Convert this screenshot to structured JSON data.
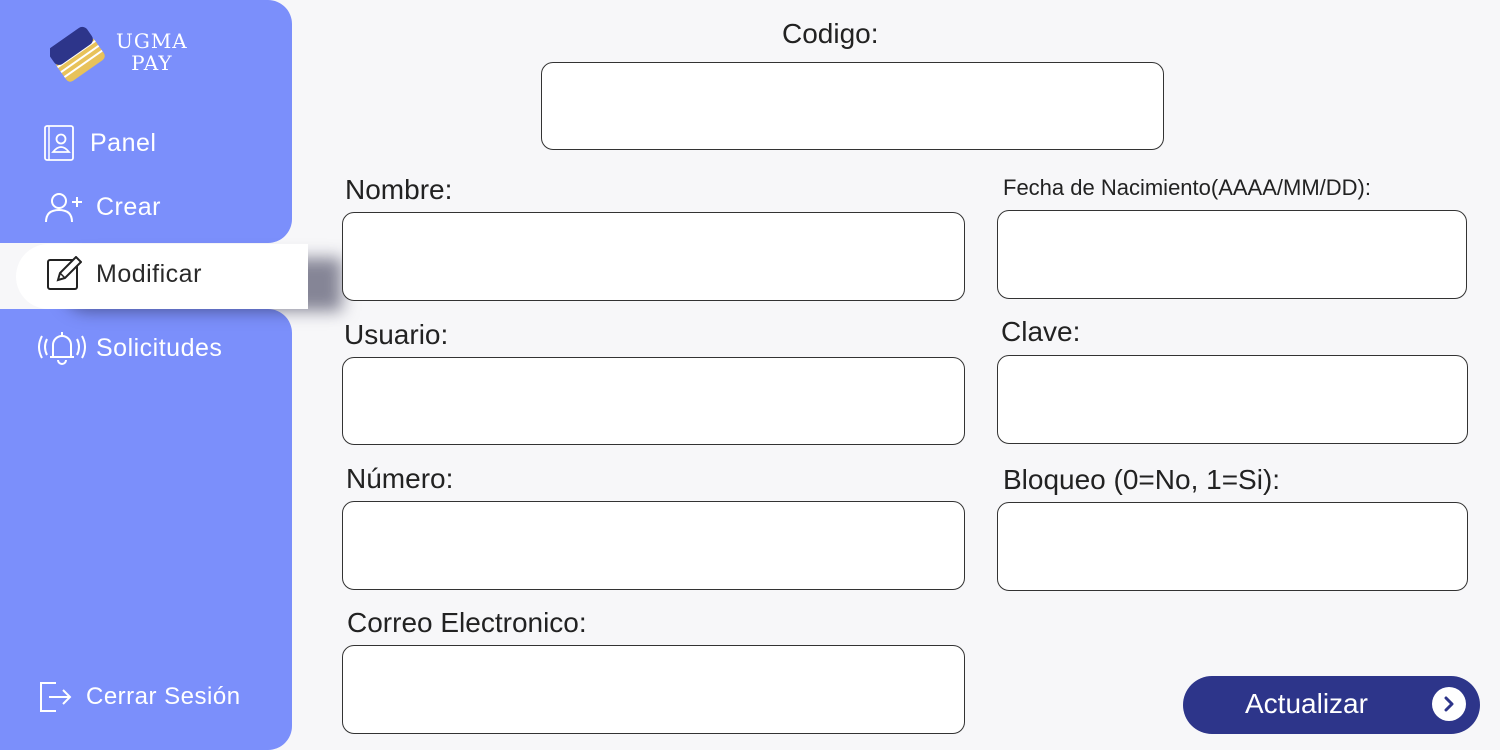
{
  "brand": {
    "line1": "UGMA",
    "line2": "PAY",
    "logo_icon": "card-stack-logo"
  },
  "sidebar": {
    "items": [
      {
        "label": "Panel",
        "icon": "contact-card-icon"
      },
      {
        "label": "Crear",
        "icon": "add-user-icon"
      },
      {
        "label": "Modificar",
        "icon": "edit-icon",
        "active": true
      },
      {
        "label": "Solicitudes",
        "icon": "bell-ringing-icon"
      }
    ],
    "logout": {
      "label": "Cerrar Sesión",
      "icon": "logout-icon"
    }
  },
  "form": {
    "codigo": {
      "label": "Codigo:",
      "value": ""
    },
    "nombre": {
      "label": "Nombre:",
      "value": ""
    },
    "fecha": {
      "label": "Fecha de Nacimiento(AAAA/MM/DD):",
      "value": ""
    },
    "usuario": {
      "label": "Usuario:",
      "value": ""
    },
    "clave": {
      "label": "Clave:",
      "value": ""
    },
    "numero": {
      "label": "Número:",
      "value": ""
    },
    "bloqueo": {
      "label": "Bloqueo (0=No, 1=Si):",
      "value": ""
    },
    "correo": {
      "label": "Correo Electronico:",
      "value": ""
    },
    "submit_label": "Actualizar"
  },
  "colors": {
    "sidebar": "#7b8ffb",
    "button": "#2d358a",
    "background": "#f7f7f9"
  }
}
